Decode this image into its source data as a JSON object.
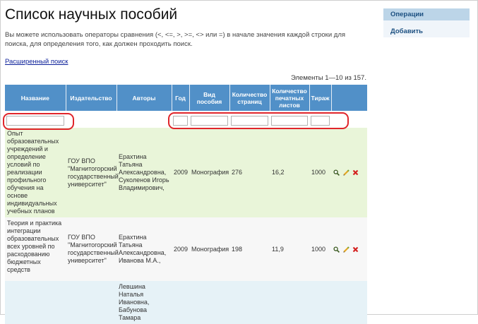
{
  "page": {
    "title": "Список научных пособий",
    "hint": "Вы можете использовать операторы сравнения (<, <=, >, >=, <> или =) в начале значения каждой строки для поиска, для определения того, как должен проходить поиск.",
    "advanced_search": "Расширенный поиск",
    "summary": "Элементы 1—10 из 157."
  },
  "operations": {
    "title": "Операции",
    "add": "Добавить"
  },
  "table": {
    "columns": [
      "Название",
      "Издательство",
      "Авторы",
      "Год",
      "Вид пособия",
      "Количество страниц",
      "Количество печатных листов",
      "Тираж"
    ],
    "rows": [
      {
        "name": "Опыт образовательных учреждений и определение условий по реализации профильного обучения на основе индивидуальных учебных планов",
        "publisher": "ГОУ ВПО \"Магнитогорский государственный университет\"",
        "authors": "Ерахтина Татьяна Александровна, Суколенов Игорь Владимирович,",
        "year": "2009",
        "kind": "Монография",
        "pages": "276",
        "sheets": "16,2",
        "copies": "1000"
      },
      {
        "name": "Теория и практика интеграции образовательных всех уровней по расходованию бюджетных средств",
        "publisher": "ГОУ ВПО \"Магнитогорский государственный университет\"",
        "authors": "Ерахтина Татьяна Александровна, Иванова М.А.,",
        "year": "2009",
        "kind": "Монография",
        "pages": "198",
        "sheets": "11,9",
        "copies": "1000"
      },
      {
        "name": "",
        "publisher": "",
        "authors": "Левшина Наталья Ивановна, Бабунова Тамара",
        "year": "",
        "kind": "",
        "pages": "",
        "sheets": "",
        "copies": ""
      }
    ]
  },
  "icons": {
    "view": "magnifier-icon",
    "edit": "pencil-icon",
    "delete": "delete-x-icon"
  },
  "colors": {
    "header": "#5190c8",
    "row_green": "#e9f5d9",
    "row_gray": "#f7f7f7",
    "row_blue": "#e6f2f7",
    "highlight": "#e0252b",
    "link": "#0b1f99"
  }
}
